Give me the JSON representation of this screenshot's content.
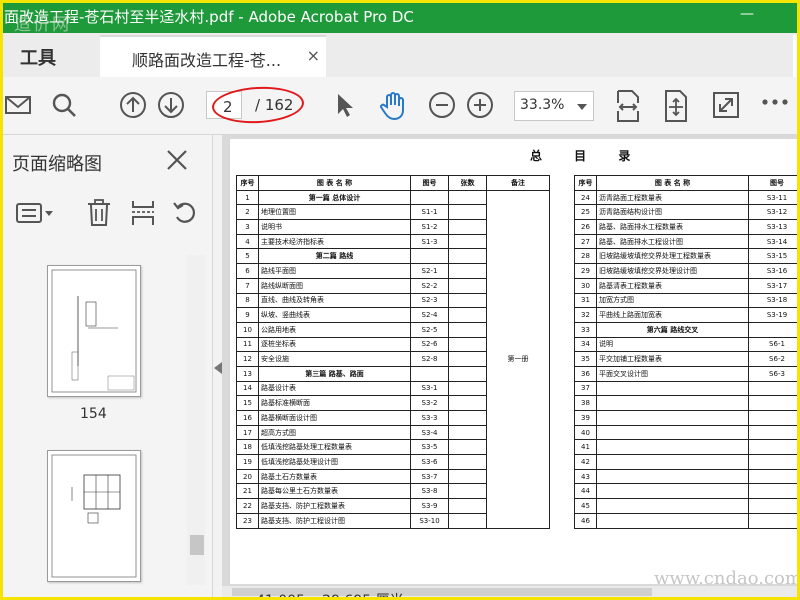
{
  "window": {
    "title": "面改造工程-苍石村至半迳水村.pdf - Adobe Acrobat Pro DC",
    "minimize_glyph": "—",
    "watermark": "造价网"
  },
  "tabs": {
    "tools_label": "工具",
    "doc_label": "顺路面改造工程-苍...",
    "close_glyph": "×"
  },
  "toolbar": {
    "page_current": "2",
    "page_total": "/ 162",
    "zoom": "33.3%",
    "icons": [
      "mail-icon",
      "search-icon",
      "page-up-icon",
      "page-down-icon",
      "select-arrow-icon",
      "hand-icon",
      "zoom-out-icon",
      "zoom-in-icon",
      "fit-page-icon",
      "fit-width-icon",
      "fullscreen-icon",
      "more-icon"
    ],
    "accent": "#1f9a3a",
    "highlight_color": "#e0191b"
  },
  "panel": {
    "title": "页面缩略图",
    "thumb_label": "154"
  },
  "document": {
    "title": "总 目 录",
    "headers": [
      "序号",
      "图 表 名 称",
      "图号",
      "张数",
      "备注"
    ],
    "volume_note": "第一册",
    "left_rows": [
      [
        "1",
        "第一篇 总体设计",
        ""
      ],
      [
        "2",
        "地理位置图",
        "S1-1"
      ],
      [
        "3",
        "说明书",
        "S1-2"
      ],
      [
        "4",
        "主要技术经济指标表",
        "S1-3"
      ],
      [
        "5",
        "第二篇 路线",
        ""
      ],
      [
        "6",
        "路线平面图",
        "S2-1"
      ],
      [
        "7",
        "路线纵断面图",
        "S2-2"
      ],
      [
        "8",
        "直线、曲线及转角表",
        "S2-3"
      ],
      [
        "9",
        "纵坡、竖曲线表",
        "S2-4"
      ],
      [
        "10",
        "公路用地表",
        "S2-5"
      ],
      [
        "11",
        "逐桩坐标表",
        "S2-6"
      ],
      [
        "12",
        "安全设施",
        "S2-8"
      ],
      [
        "13",
        "第三篇 路基、路面",
        ""
      ],
      [
        "14",
        "路基设计表",
        "S3-1"
      ],
      [
        "15",
        "路基标准横断面",
        "S3-2"
      ],
      [
        "16",
        "路基横断面设计图",
        "S3-3"
      ],
      [
        "17",
        "超高方式图",
        "S3-4"
      ],
      [
        "18",
        "低填浅挖路基处理工程数量表",
        "S3-5"
      ],
      [
        "19",
        "低填浅挖路基处理设计图",
        "S3-6"
      ],
      [
        "20",
        "路基土石方数量表",
        "S3-7"
      ],
      [
        "21",
        "路基每公里土石方数量表",
        "S3-8"
      ],
      [
        "22",
        "路基支挡、防护工程数量表",
        "S3-9"
      ],
      [
        "23",
        "路基支挡、防护工程设计图",
        "S3-10"
      ]
    ],
    "right_rows": [
      [
        "24",
        "沥青路面工程数量表",
        "S3-11"
      ],
      [
        "25",
        "沥青路面结构设计图",
        "S3-12"
      ],
      [
        "26",
        "路基、路面排水工程数量表",
        "S3-13"
      ],
      [
        "27",
        "路基、路面排水工程设计图",
        "S3-14"
      ],
      [
        "28",
        "旧坡路缓坡填挖交界处理工程数量表",
        "S3-15"
      ],
      [
        "29",
        "旧坡路缓坡填挖交界处理设计图",
        "S3-16"
      ],
      [
        "30",
        "路基清表工程数量表",
        "S3-17"
      ],
      [
        "31",
        "加宽方式图",
        "S3-18"
      ],
      [
        "32",
        "平曲线上路面加宽表",
        "S3-19"
      ],
      [
        "33",
        "第六篇 路线交叉",
        ""
      ],
      [
        "34",
        "说明",
        "S6-1"
      ],
      [
        "35",
        "平交加铺工程数量表",
        "S6-2"
      ],
      [
        "36",
        "平面交叉设计图",
        "S6-3"
      ],
      [
        "37",
        "",
        ""
      ],
      [
        "38",
        "",
        ""
      ],
      [
        "39",
        "",
        ""
      ],
      [
        "40",
        "",
        ""
      ],
      [
        "41",
        "",
        ""
      ],
      [
        "42",
        "",
        ""
      ],
      [
        "43",
        "",
        ""
      ],
      [
        "44",
        "",
        ""
      ],
      [
        "45",
        "",
        ""
      ],
      [
        "46",
        "",
        ""
      ]
    ]
  },
  "status": {
    "dimensions": "41.005 x 29.695 厘米",
    "site_watermark": "www.cndao.com"
  }
}
